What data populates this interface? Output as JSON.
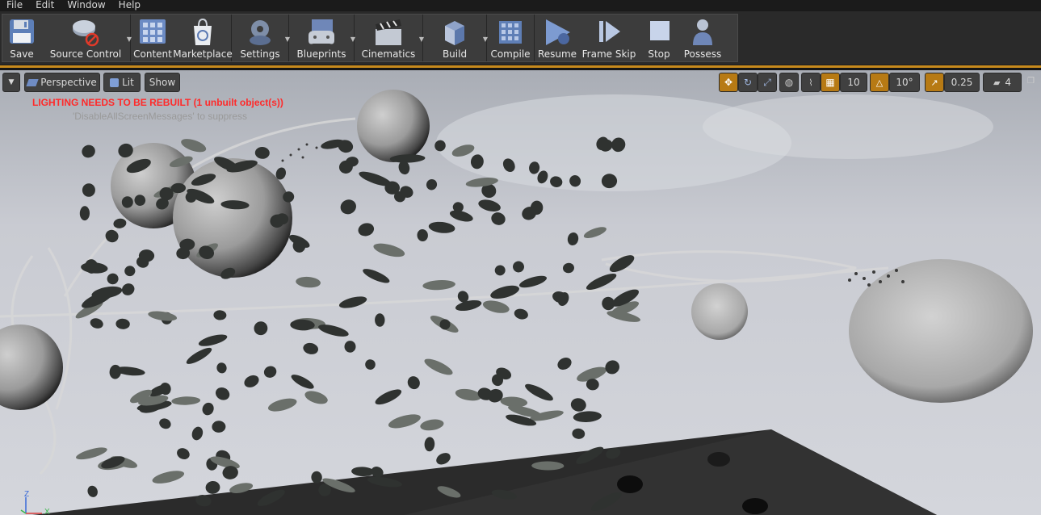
{
  "menu": [
    "File",
    "Edit",
    "Window",
    "Help"
  ],
  "toolbar": {
    "save": "Save",
    "source_control": "Source Control",
    "content": "Content",
    "marketplace": "Marketplace",
    "settings": "Settings",
    "blueprints": "Blueprints",
    "cinematics": "Cinematics",
    "build": "Build",
    "compile": "Compile",
    "resume": "Resume",
    "frame_skip": "Frame Skip",
    "stop": "Stop",
    "possess": "Possess"
  },
  "viewport": {
    "view_mode": "Perspective",
    "lit_mode": "Lit",
    "show": "Show",
    "grid_size": "10",
    "rotation_snap": "10°",
    "scale_snap": "0.25",
    "camera_speed": "4",
    "lighting_warning": "LIGHTING NEEDS TO BE REBUILT (1 unbuilt object(s))",
    "suppress_hint": "'DisableAllScreenMessages' to suppress",
    "axis_z": "Z",
    "axis_x": "X"
  },
  "colors": {
    "accent": "#c78a1d",
    "warning": "#ff2a2a",
    "toolbar_bg": "#3c3c3c"
  }
}
